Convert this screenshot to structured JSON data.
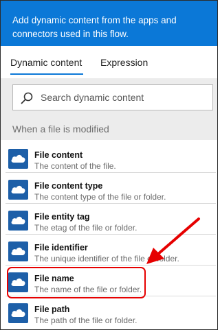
{
  "banner": {
    "text": "Add dynamic content from the apps and connectors used in this flow."
  },
  "tabs": [
    {
      "label": "Dynamic content",
      "active": true
    },
    {
      "label": "Expression",
      "active": false
    }
  ],
  "search": {
    "placeholder": "Search dynamic content",
    "value": ""
  },
  "section": {
    "title": "When a file is modified"
  },
  "items": [
    {
      "title": "File content",
      "desc": "The content of the file.",
      "icon": "onedrive-cloud-icon"
    },
    {
      "title": "File content type",
      "desc": "The content type of the file or folder.",
      "icon": "onedrive-cloud-icon"
    },
    {
      "title": "File entity tag",
      "desc": "The etag of the file or folder.",
      "icon": "onedrive-cloud-icon"
    },
    {
      "title": "File identifier",
      "desc": "The unique identifier of the file or folder.",
      "icon": "onedrive-cloud-icon"
    },
    {
      "title": "File name",
      "desc": "The name of the file or folder.",
      "icon": "onedrive-cloud-icon",
      "highlighted": true
    },
    {
      "title": "File path",
      "desc": "The path of the file or folder.",
      "icon": "onedrive-cloud-icon"
    }
  ],
  "colors": {
    "accent": "#0b78d7",
    "icon_bg": "#1d5fa8",
    "annotation": "#e60000"
  }
}
